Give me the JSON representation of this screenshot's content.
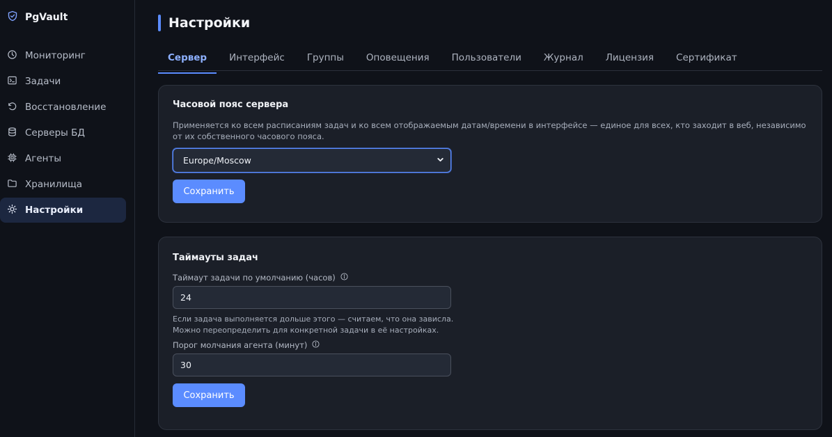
{
  "brand": {
    "name": "PgVault",
    "icon": "shield-check-icon"
  },
  "sidebar": {
    "items": [
      {
        "label": "Мониторинг",
        "icon": "clock-icon",
        "active": false
      },
      {
        "label": "Задачи",
        "icon": "terminal-icon",
        "active": false
      },
      {
        "label": "Восстановление",
        "icon": "restore-icon",
        "active": false
      },
      {
        "label": "Серверы БД",
        "icon": "database-icon",
        "active": false
      },
      {
        "label": "Агенты",
        "icon": "cpu-icon",
        "active": false
      },
      {
        "label": "Хранилища",
        "icon": "folder-icon",
        "active": false
      },
      {
        "label": "Настройки",
        "icon": "sun-gear-icon",
        "active": true
      }
    ]
  },
  "page": {
    "title": "Настройки"
  },
  "tabs": [
    {
      "label": "Сервер",
      "active": true
    },
    {
      "label": "Интерфейс",
      "active": false
    },
    {
      "label": "Группы",
      "active": false
    },
    {
      "label": "Оповещения",
      "active": false
    },
    {
      "label": "Пользователи",
      "active": false
    },
    {
      "label": "Журнал",
      "active": false
    },
    {
      "label": "Лицензия",
      "active": false
    },
    {
      "label": "Сертификат",
      "active": false
    }
  ],
  "timezone_card": {
    "title": "Часовой пояс сервера",
    "description": "Применяется ко всем расписаниям задач и ко всем отображаемым датам/времени в интерфейсе — единое для всех, кто заходит в веб, независимо от их собственного часового пояса.",
    "select_value": "Europe/Moscow",
    "save_label": "Сохранить"
  },
  "timeouts_card": {
    "title": "Таймауты задач",
    "task_timeout_label": "Таймаут задачи по умолчанию (часов)",
    "task_timeout_value": "24",
    "task_timeout_hint_line1": "Если задача выполняется дольше этого — считаем, что она зависла.",
    "task_timeout_hint_line2": "Можно переопределить для конкретной задачи в её настройках.",
    "agent_silence_label": "Порог молчания агента (минут)",
    "agent_silence_value": "30",
    "save_label": "Сохранить"
  },
  "colors": {
    "accent": "#5b8cff",
    "background": "#0f1219",
    "card": "#1b1f28",
    "active_nav": "#1c2740"
  }
}
